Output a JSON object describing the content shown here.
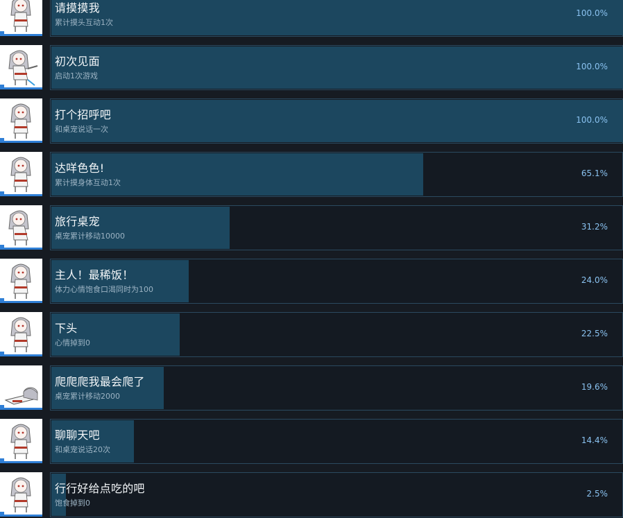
{
  "achievements": [
    {
      "title": "请摸摸我",
      "description": "累计摸头互动1次",
      "percent_label": "100.0%",
      "percent": 100.0,
      "icon": "chibi-girl-sitting-icon"
    },
    {
      "title": "初次见面",
      "description": "启动1次游戏",
      "percent_label": "100.0%",
      "percent": 100.0,
      "icon": "chibi-girl-pointing-icon"
    },
    {
      "title": "打个招呼吧",
      "description": "和桌宠说话一次",
      "percent_label": "100.0%",
      "percent": 100.0,
      "icon": "chibi-girl-standing-icon"
    },
    {
      "title": "达咩色色!",
      "description": "累计摸身体互动1次",
      "percent_label": "65.1%",
      "percent": 65.1,
      "icon": "chibi-girl-shy-icon"
    },
    {
      "title": "旅行桌宠",
      "description": "桌宠累计移动10000",
      "percent_label": "31.2%",
      "percent": 31.2,
      "icon": "chibi-girl-walking-icon"
    },
    {
      "title": "主人！最稀饭！",
      "description": "体力心情饱食口渴同时为100",
      "percent_label": "24.0%",
      "percent": 24.0,
      "icon": "chibi-girl-happy-icon"
    },
    {
      "title": "下头",
      "description": "心情掉到0",
      "percent_label": "22.5%",
      "percent": 22.5,
      "icon": "chibi-girl-sad-icon"
    },
    {
      "title": "爬爬爬我最会爬了",
      "description": "桌宠累计移动2000",
      "percent_label": "19.6%",
      "percent": 19.6,
      "icon": "chibi-girl-crawling-icon"
    },
    {
      "title": "聊聊天吧",
      "description": "和桌宠说话20次",
      "percent_label": "14.4%",
      "percent": 14.4,
      "icon": "chibi-girl-talking-icon"
    },
    {
      "title": "行行好给点吃的吧",
      "description": "饱食掉到0",
      "percent_label": "2.5%",
      "percent": 2.5,
      "icon": "chibi-girl-hungry-icon"
    }
  ],
  "colors": {
    "background": "#161b22",
    "bar_fill": "#1c475f",
    "bar_border": "#2b4a60",
    "percent_text": "#8ac2f0",
    "thumb_accent": "#2f7fd6"
  }
}
